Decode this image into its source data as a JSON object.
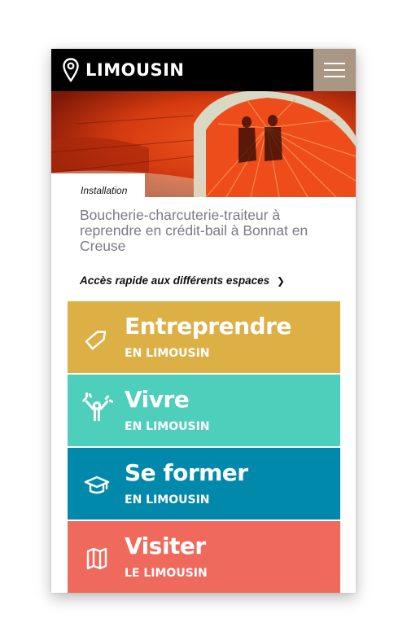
{
  "header": {
    "brand": "LIMOUSIN",
    "logo_icon": "location-pin-icon",
    "menu_icon": "hamburger-menu-icon",
    "colors": {
      "bar": "#000000",
      "menu_button": "#a99783"
    }
  },
  "article": {
    "category": "Installation",
    "title": "Boucherie-charcuterie-traiteur à reprendre en crédit-bail à Bonnat en Creuse"
  },
  "quick_access": {
    "label": "Accès rapide aux différents espaces",
    "arrow": "❯"
  },
  "tiles": [
    {
      "main": "Entreprendre",
      "sub": "EN LIMOUSIN",
      "icon": "tag-label-icon",
      "color": "#dcb045"
    },
    {
      "main": "Vivre",
      "sub": "EN LIMOUSIN",
      "icon": "celebrating-person-icon",
      "color": "#4ecfbc"
    },
    {
      "main": "Se former",
      "sub": "EN LIMOUSIN",
      "icon": "graduation-cap-icon",
      "color": "#0089ab"
    },
    {
      "main": "Visiter",
      "sub": "LE LIMOUSIN",
      "icon": "folded-map-icon",
      "color": "#ef6a5c"
    }
  ]
}
